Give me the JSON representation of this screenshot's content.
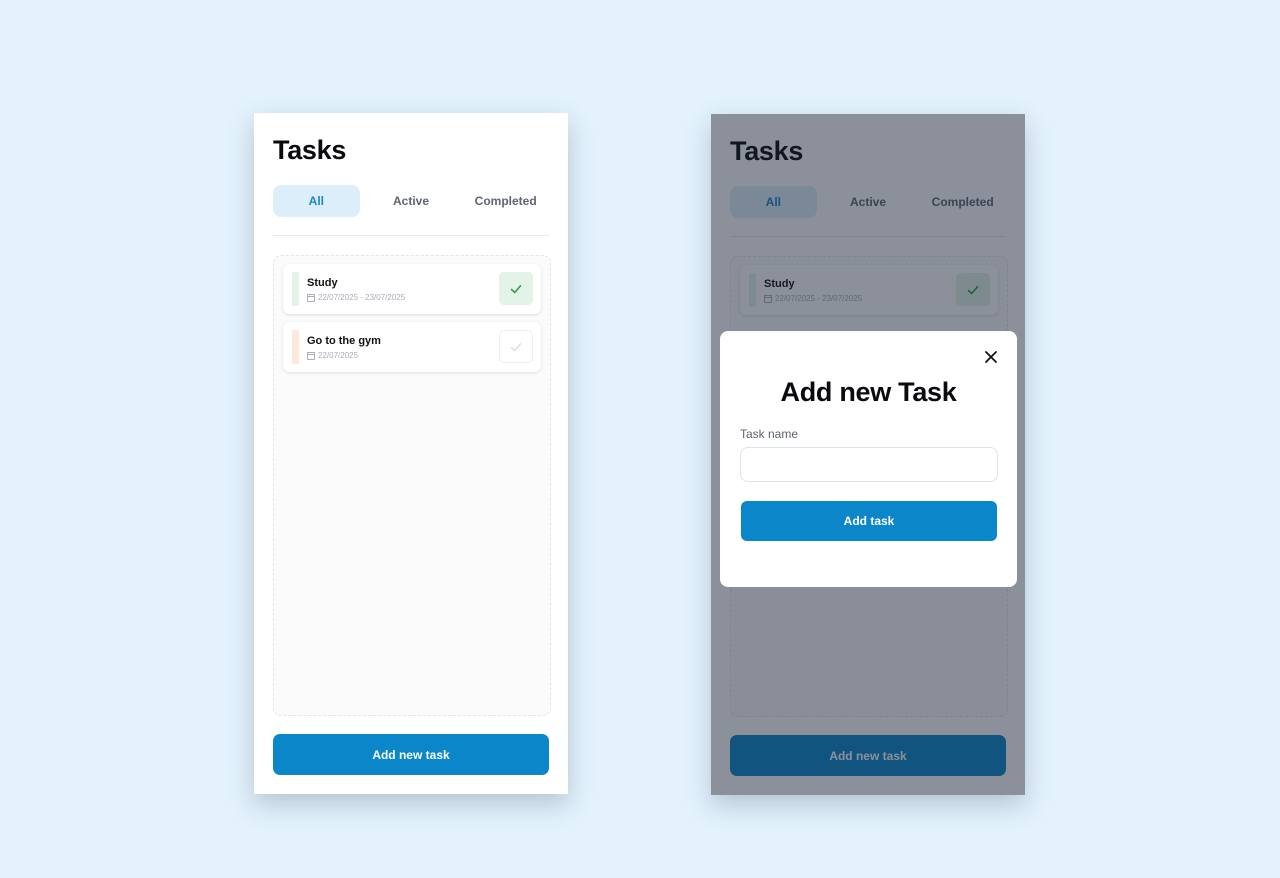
{
  "screens": {
    "list": {
      "title": "Tasks",
      "tabs": [
        {
          "label": "All",
          "active": true
        },
        {
          "label": "Active",
          "active": false
        },
        {
          "label": "Completed",
          "active": false
        }
      ],
      "tasks": [
        {
          "name": "Study",
          "date": "22/07/2025 - 23/07/2025",
          "completed": true,
          "accent_color": "#e2f3e8"
        },
        {
          "name": "Go to the gym",
          "date": "22/07/2025",
          "completed": false,
          "accent_color": "#fde8dc"
        }
      ],
      "add_button": "Add new task"
    },
    "modal": {
      "title": "Add new Task",
      "field_label": "Task name",
      "field_value": "",
      "field_placeholder": "",
      "submit_button": "Add task",
      "close_icon": "close-icon"
    }
  },
  "colors": {
    "background": "#e3f2fc",
    "primary": "#0a86c9",
    "tab_active_bg": "#ddeefb",
    "tab_active_text": "#1b86c8",
    "completed_check_bg": "#e3f3e7",
    "check_color": "#2fa34a"
  }
}
